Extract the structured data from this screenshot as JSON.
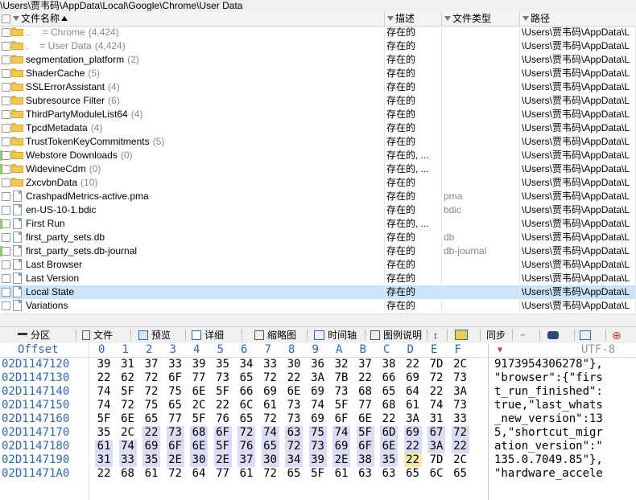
{
  "path": "\\Users\\贾韦码\\AppData\\Local\\Google\\Chrome\\User Data",
  "columns": {
    "name": "文件名称",
    "desc": "描述",
    "type": "文件类型",
    "path": "路径"
  },
  "rows": [
    {
      "name": "..",
      "extra": "=   Chrome",
      "count": "(4,424)",
      "desc": "存在的",
      "type": "",
      "path": "\\Users\\贾韦码\\AppData\\L",
      "kind": "folder",
      "dim": true
    },
    {
      "name": ".",
      "extra": "=   User Data",
      "count": "(4,424)",
      "desc": "存在的",
      "type": "",
      "path": "\\Users\\贾韦码\\AppData\\L",
      "kind": "folder",
      "dim": true
    },
    {
      "name": "segmentation_platform",
      "count": "(2)",
      "desc": "存在的",
      "type": "",
      "path": "\\Users\\贾韦码\\AppData\\L",
      "kind": "folder"
    },
    {
      "name": "ShaderCache",
      "count": "(5)",
      "desc": "存在的",
      "type": "",
      "path": "\\Users\\贾韦码\\AppData\\L",
      "kind": "folder"
    },
    {
      "name": "SSLErrorAssistant",
      "count": "(4)",
      "desc": "存在的",
      "type": "",
      "path": "\\Users\\贾韦码\\AppData\\L",
      "kind": "folder"
    },
    {
      "name": "Subresource Filter",
      "count": "(6)",
      "desc": "存在的",
      "type": "",
      "path": "\\Users\\贾韦码\\AppData\\L",
      "kind": "folder"
    },
    {
      "name": "ThirdPartyModuleList64",
      "count": "(4)",
      "desc": "存在的",
      "type": "",
      "path": "\\Users\\贾韦码\\AppData\\L",
      "kind": "folder"
    },
    {
      "name": "TpcdMetadata",
      "count": "(4)",
      "desc": "存在的",
      "type": "",
      "path": "\\Users\\贾韦码\\AppData\\L",
      "kind": "folder"
    },
    {
      "name": "TrustTokenKeyCommitments",
      "count": "(5)",
      "desc": "存在的",
      "type": "",
      "path": "\\Users\\贾韦码\\AppData\\L",
      "kind": "folder"
    },
    {
      "name": "Webstore Downloads",
      "count": "(0)",
      "desc": "存在的, ...",
      "type": "",
      "path": "\\Users\\贾韦码\\AppData\\L",
      "kind": "folder",
      "mark": true
    },
    {
      "name": "WidevineCdm",
      "count": "(0)",
      "desc": "存在的, ...",
      "type": "",
      "path": "\\Users\\贾韦码\\AppData\\L",
      "kind": "folder",
      "mark": true
    },
    {
      "name": "ZxcvbnData",
      "count": "(10)",
      "desc": "存在的",
      "type": "",
      "path": "\\Users\\贾韦码\\AppData\\L",
      "kind": "folder"
    },
    {
      "name": "CrashpadMetrics-active.pma",
      "count": "",
      "desc": "存在的",
      "type": "pma",
      "path": "\\Users\\贾韦码\\AppData\\L",
      "kind": "file"
    },
    {
      "name": "en-US-10-1.bdic",
      "count": "",
      "desc": "存在的",
      "type": "bdic",
      "path": "\\Users\\贾韦码\\AppData\\L",
      "kind": "file"
    },
    {
      "name": "First Run",
      "count": "",
      "desc": "存在的, ...",
      "type": "",
      "path": "\\Users\\贾韦码\\AppData\\L",
      "kind": "file",
      "mark": true
    },
    {
      "name": "first_party_sets.db",
      "count": "",
      "desc": "存在的",
      "type": "db",
      "path": "\\Users\\贾韦码\\AppData\\L",
      "kind": "file"
    },
    {
      "name": "first_party_sets.db-journal",
      "count": "",
      "desc": "存在的",
      "type": "db-journal",
      "path": "\\Users\\贾韦码\\AppData\\L",
      "kind": "file",
      "mark": true
    },
    {
      "name": "Last Browser",
      "count": "",
      "desc": "存在的",
      "type": "",
      "path": "\\Users\\贾韦码\\AppData\\L",
      "kind": "file"
    },
    {
      "name": "Last Version",
      "count": "",
      "desc": "存在的",
      "type": "",
      "path": "\\Users\\贾韦码\\AppData\\L",
      "kind": "file"
    },
    {
      "name": "Local State",
      "count": "",
      "desc": "存在的",
      "type": "",
      "path": "\\Users\\贾韦码\\AppData\\L",
      "kind": "file",
      "selected": true
    },
    {
      "name": "Variations",
      "count": "",
      "desc": "存在的",
      "type": "",
      "path": "\\Users\\贾韦码\\AppData\\L",
      "kind": "file"
    }
  ],
  "toolbar": {
    "partition": "分区",
    "file": "文件",
    "preview": "预览",
    "details": "详细",
    "thumbnails": "缩略图",
    "timeline": "时间轴",
    "legend": "图例说明",
    "sync": "同步"
  },
  "hex": {
    "offset_label": "Offset",
    "col_labels": [
      "0",
      "1",
      "2",
      "3",
      "4",
      "5",
      "6",
      "7",
      "8",
      "9",
      "A",
      "B",
      "C",
      "D",
      "E",
      "F"
    ],
    "encoding": "UTF-8",
    "rows": [
      {
        "offset": "02D1147120",
        "bytes": [
          "39",
          "31",
          "37",
          "33",
          "39",
          "35",
          "34",
          "33",
          "30",
          "36",
          "32",
          "37",
          "38",
          "22",
          "7D",
          "2C"
        ],
        "text": "9173954306278\"},"
      },
      {
        "offset": "02D1147130",
        "bytes": [
          "22",
          "62",
          "72",
          "6F",
          "77",
          "73",
          "65",
          "72",
          "22",
          "3A",
          "7B",
          "22",
          "66",
          "69",
          "72",
          "73"
        ],
        "text": "\"browser\":{\"firs"
      },
      {
        "offset": "02D1147140",
        "bytes": [
          "74",
          "5F",
          "72",
          "75",
          "6E",
          "5F",
          "66",
          "69",
          "6E",
          "69",
          "73",
          "68",
          "65",
          "64",
          "22",
          "3A"
        ],
        "text": "t_run_finished\":"
      },
      {
        "offset": "02D1147150",
        "bytes": [
          "74",
          "72",
          "75",
          "65",
          "2C",
          "22",
          "6C",
          "61",
          "73",
          "74",
          "5F",
          "77",
          "68",
          "61",
          "74",
          "73"
        ],
        "text": "true,\"last_whats"
      },
      {
        "offset": "02D1147160",
        "bytes": [
          "5F",
          "6E",
          "65",
          "77",
          "5F",
          "76",
          "65",
          "72",
          "73",
          "69",
          "6F",
          "6E",
          "22",
          "3A",
          "31",
          "33"
        ],
        "text": "_new_version\":13"
      },
      {
        "offset": "02D1147170",
        "bytes": [
          "35",
          "2C",
          "22",
          "73",
          "68",
          "6F",
          "72",
          "74",
          "63",
          "75",
          "74",
          "5F",
          "6D",
          "69",
          "67",
          "72"
        ],
        "text": "5,\"shortcut_migr"
      },
      {
        "offset": "02D1147180",
        "bytes": [
          "61",
          "74",
          "69",
          "6F",
          "6E",
          "5F",
          "76",
          "65",
          "72",
          "73",
          "69",
          "6F",
          "6E",
          "22",
          "3A",
          "22"
        ],
        "text": "ation_version\":\""
      },
      {
        "offset": "02D1147190",
        "bytes": [
          "31",
          "33",
          "35",
          "2E",
          "30",
          "2E",
          "37",
          "30",
          "34",
          "39",
          "2E",
          "38",
          "35",
          "22",
          "7D",
          "2C"
        ],
        "text": "135.0.7049.85\"},"
      },
      {
        "offset": "02D11471A0",
        "bytes": [
          "22",
          "68",
          "61",
          "72",
          "64",
          "77",
          "61",
          "72",
          "65",
          "5F",
          "61",
          "63",
          "63",
          "65",
          "6C",
          "65"
        ],
        "text": "\"hardware_accele"
      }
    ]
  }
}
